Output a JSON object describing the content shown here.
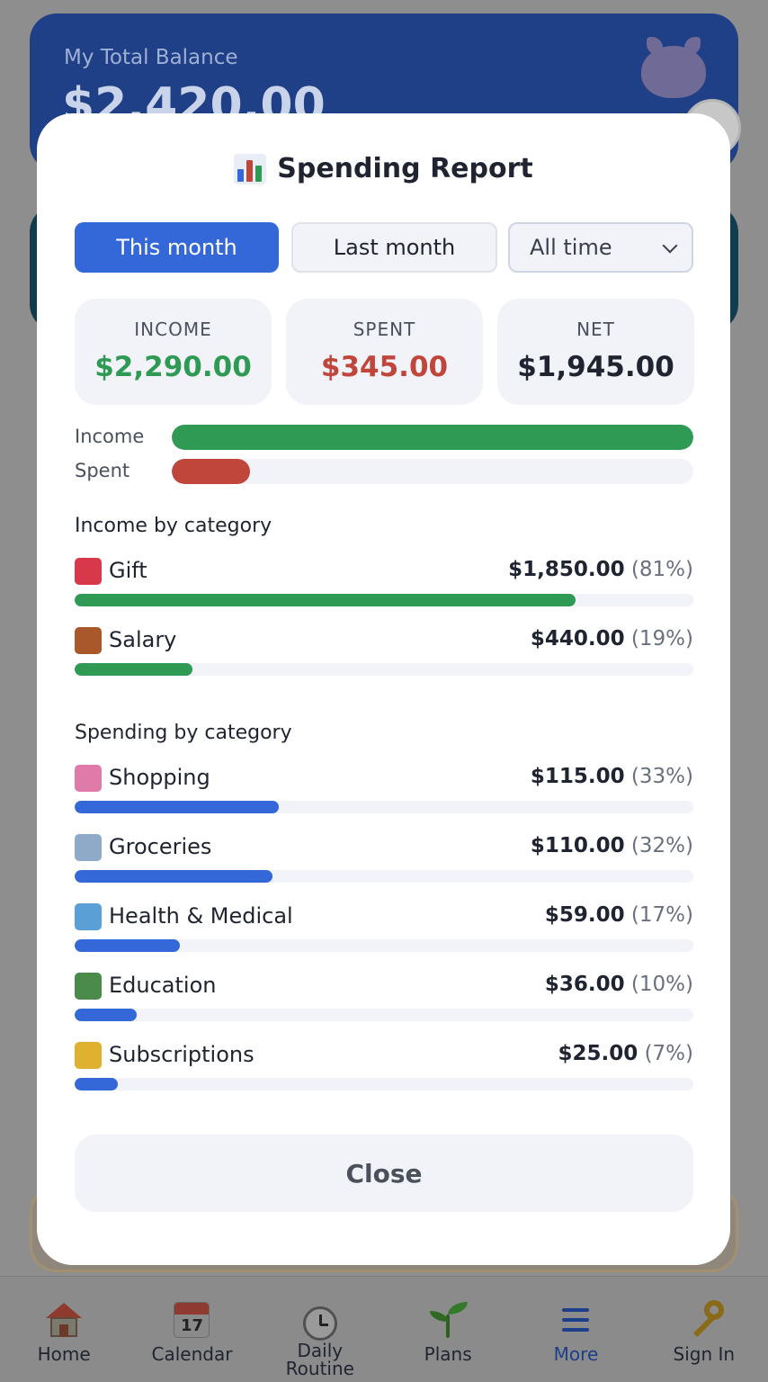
{
  "background": {
    "balance_label": "My Total Balance",
    "balance_amount": "$2,420.00"
  },
  "modal": {
    "title": "Spending Report",
    "title_icon": "bar-chart-icon",
    "tabs": {
      "this_month": "This month",
      "last_month": "Last month",
      "range_select": "All time",
      "selected": "This month"
    },
    "stats": {
      "income": {
        "label": "INCOME",
        "value": "$2,290.00"
      },
      "spent": {
        "label": "SPENT",
        "value": "$345.00"
      },
      "net": {
        "label": "NET",
        "value": "$1,945.00"
      }
    },
    "comparison": {
      "income_label": "Income",
      "spent_label": "Spent",
      "income_fraction": 1.0,
      "spent_fraction": 0.15
    },
    "income_section_title": "Income by category",
    "income_categories": [
      {
        "icon": "gift-icon",
        "name": "Gift",
        "amount": "$1,850.00",
        "percent": "(81%)",
        "fraction": 0.81
      },
      {
        "icon": "briefcase-icon",
        "name": "Salary",
        "amount": "$440.00",
        "percent": "(19%)",
        "fraction": 0.19
      }
    ],
    "spending_section_title": "Spending by category",
    "spending_categories": [
      {
        "icon": "shopping-bags-icon",
        "name": "Shopping",
        "amount": "$115.00",
        "percent": "(33%)",
        "fraction": 0.33
      },
      {
        "icon": "shopping-cart-icon",
        "name": "Groceries",
        "amount": "$110.00",
        "percent": "(32%)",
        "fraction": 0.32
      },
      {
        "icon": "hospital-icon",
        "name": "Health & Medical",
        "amount": "$59.00",
        "percent": "(17%)",
        "fraction": 0.17
      },
      {
        "icon": "books-icon",
        "name": "Education",
        "amount": "$36.00",
        "percent": "(10%)",
        "fraction": 0.1
      },
      {
        "icon": "credit-card-icon",
        "name": "Subscriptions",
        "amount": "$25.00",
        "percent": "(7%)",
        "fraction": 0.07
      }
    ],
    "close_label": "Close"
  },
  "bottom_nav": {
    "items": [
      {
        "label": "Home",
        "icon": "house-icon"
      },
      {
        "label": "Calendar",
        "icon": "calendar-icon",
        "icon_text": "17"
      },
      {
        "label": "Daily Routine",
        "icon": "clock-icon"
      },
      {
        "label": "Plans",
        "icon": "sprout-icon"
      },
      {
        "label": "More",
        "icon": "menu-icon",
        "active": true
      },
      {
        "label": "Sign In",
        "icon": "key-icon"
      }
    ]
  },
  "colors": {
    "accent_blue": "#3468d8",
    "income_green": "#2f9a53",
    "spent_red": "#c0453a",
    "card_navy": "#1f3f86"
  }
}
